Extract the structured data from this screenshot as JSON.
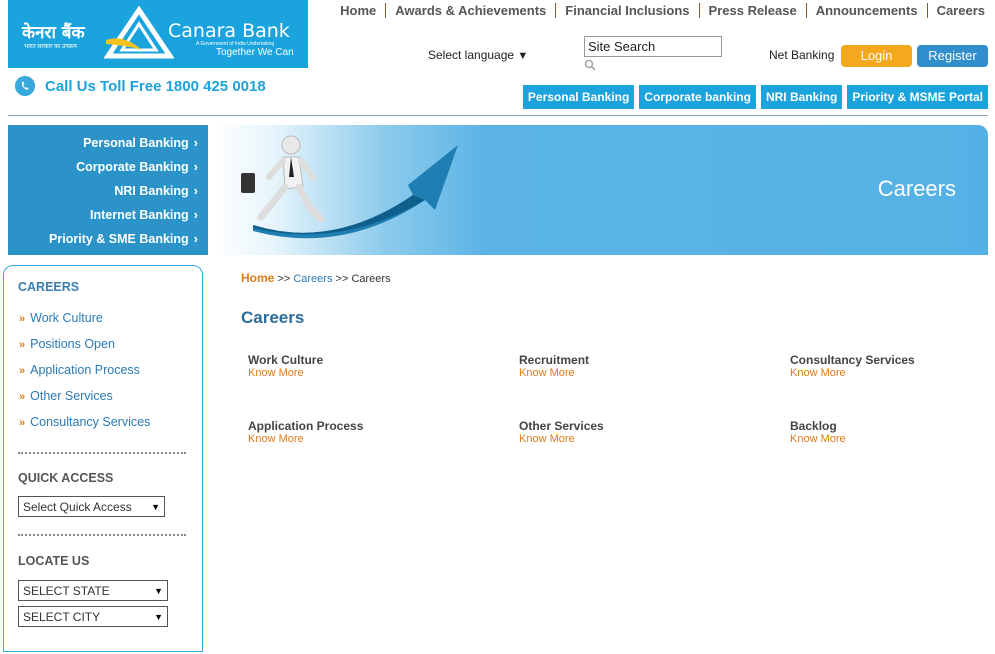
{
  "logo": {
    "hindi": "केनरा बैंक",
    "hindi_sub": "भारत सरकार का उपक्रम",
    "brand": "Canara Bank",
    "brand_sub": "A Government of India Undertaking",
    "tagline": "Together We Can"
  },
  "topnav": [
    "Home",
    "Awards & Achievements",
    "Financial Inclusions",
    "Press Release",
    "Announcements",
    "Careers"
  ],
  "header": {
    "language_label": "Select language",
    "search_value": "Site Search",
    "netbanking_label": "Net Banking",
    "login_label": "Login",
    "register_label": "Register",
    "call_us": "Call Us Toll Free 1800 425 0018"
  },
  "tabnav": [
    "Personal Banking",
    "Corporate banking",
    "NRI Banking",
    "Priority & MSME Portal"
  ],
  "sidemenu": [
    "Personal Banking",
    "Corporate Banking",
    "NRI Banking",
    "Internet Banking",
    "Priority & SME Banking"
  ],
  "banner": {
    "title": "Careers"
  },
  "sidebar": {
    "careers_heading": "CAREERS",
    "links": [
      "Work Culture",
      "Positions Open",
      "Application Process",
      "Other Services",
      "Consultancy Services"
    ],
    "quick_access_heading": "QUICK ACCESS",
    "quick_access_select": "Select Quick Access",
    "locate_heading": "LOCATE US",
    "state_select": "SELECT STATE",
    "city_select": "SELECT CITY"
  },
  "breadcrumb": {
    "home": "Home",
    "sep": ">>",
    "mid": "Careers",
    "current": "Careers"
  },
  "main": {
    "title": "Careers",
    "know_more": "Know More",
    "cards": [
      "Work Culture",
      "Recruitment",
      "Consultancy Services",
      "Application Process",
      "Other Services",
      "Backlog"
    ]
  },
  "colors": {
    "brand_blue": "#1aa3dd",
    "accent_orange": "#e07b1a",
    "login_yellow": "#f4a81c",
    "register_blue": "#2f8ecb"
  }
}
